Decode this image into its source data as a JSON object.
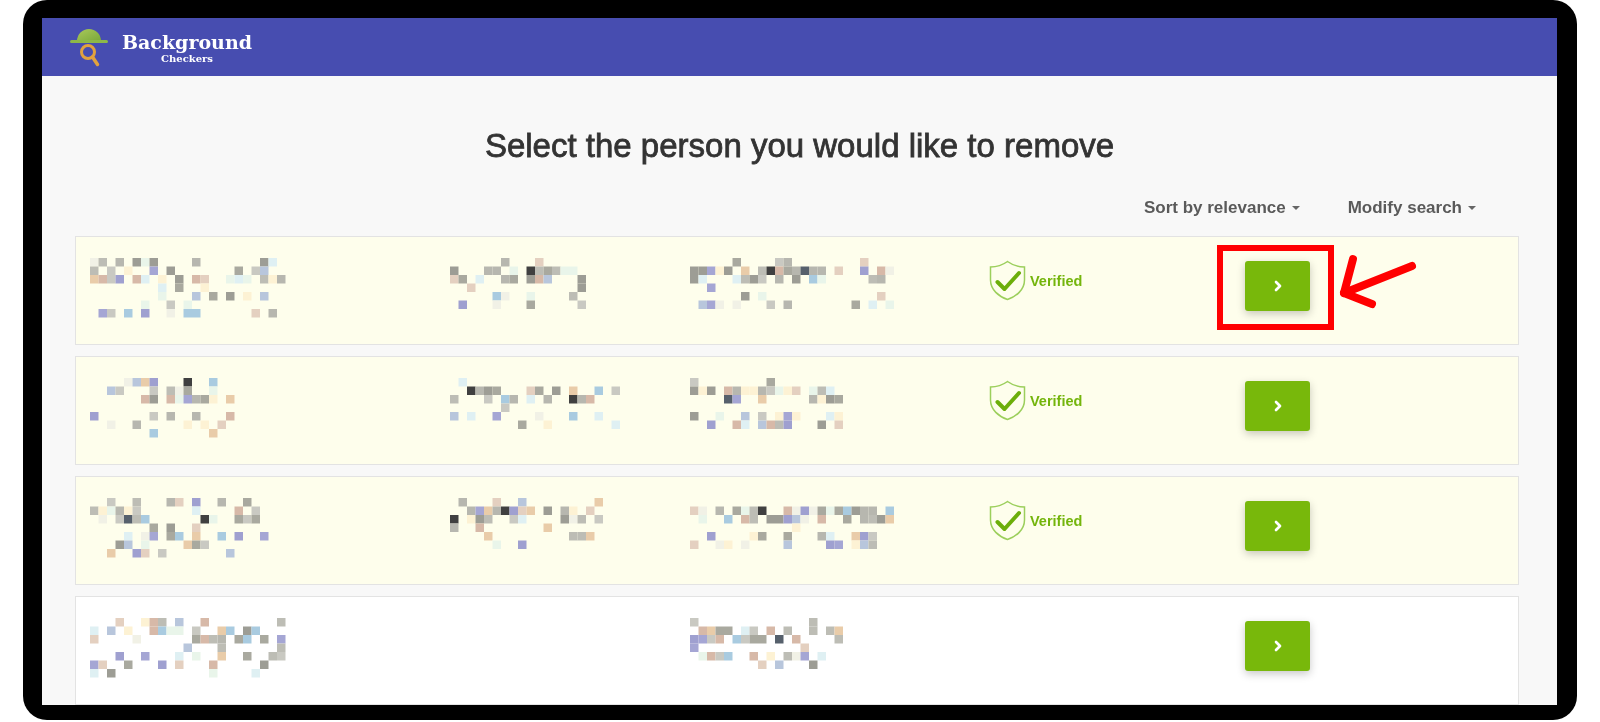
{
  "header": {
    "logo": {
      "title": "Background",
      "subtitle": "Checkers"
    }
  },
  "title": "Select the person you would like to remove",
  "controls": [
    {
      "label": "Sort by relevance"
    },
    {
      "label": "Modify search"
    }
  ],
  "rows": [
    {
      "highlighted": true,
      "marked": true,
      "cells": [
        {
          "kind": "pixelated"
        },
        {
          "kind": "pixelated"
        },
        {
          "kind": "pixelated"
        }
      ],
      "badge": "Verified"
    },
    {
      "highlighted": true,
      "marked": false,
      "cells": [
        {
          "kind": "pixelated"
        },
        {
          "kind": "pixelated"
        },
        {
          "kind": "pixelated"
        }
      ],
      "badge": "Verified"
    },
    {
      "highlighted": true,
      "marked": false,
      "cells": [
        {
          "kind": "pixelated"
        },
        {
          "kind": "pixelated"
        },
        {
          "kind": "pixelated"
        }
      ],
      "badge": "Verified"
    },
    {
      "highlighted": false,
      "marked": false,
      "cells": [
        {
          "kind": "pixelated"
        },
        {
          "kind": "blank"
        },
        {
          "kind": "pixelated"
        }
      ]
    }
  ]
}
